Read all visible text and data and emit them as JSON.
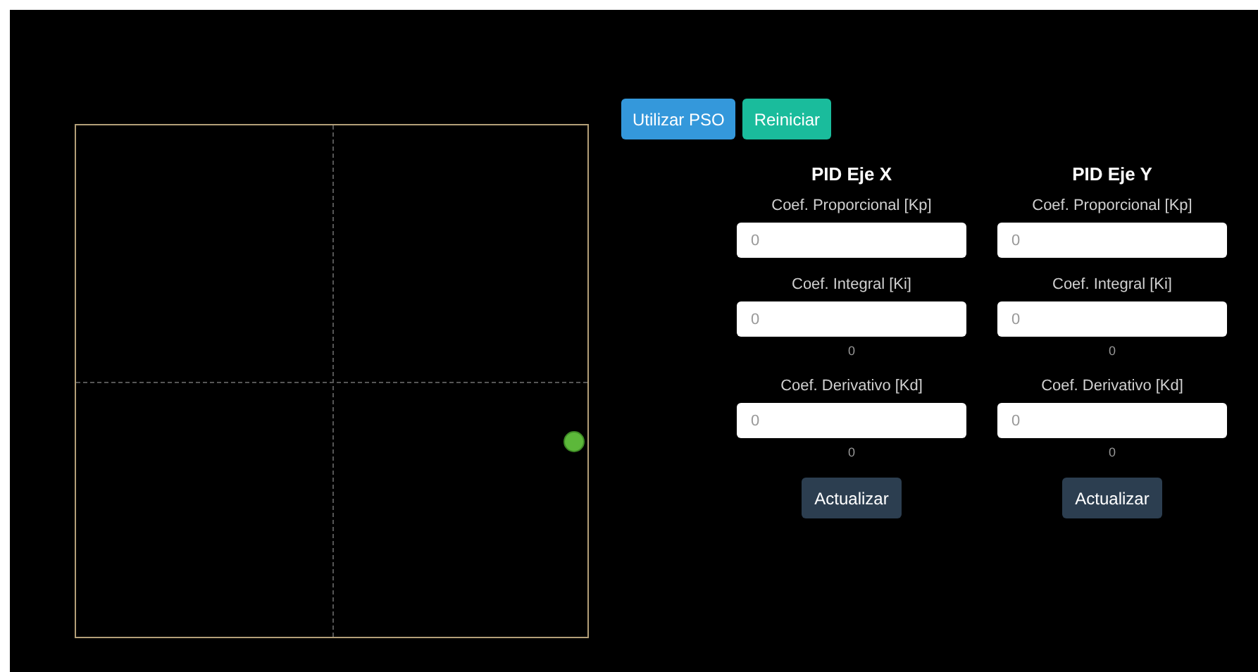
{
  "buttons": [
    {
      "label": "Utilizar PSO",
      "kind": "primary"
    },
    {
      "label": "Reiniciar",
      "kind": "success"
    }
  ],
  "controllers": [
    {
      "title": "PID Eje X",
      "fields": [
        {
          "label": "Coef. Proporcional [Kp]",
          "placeholder": "0"
        },
        {
          "label": "Coef. Integral [Ki]",
          "placeholder": "0",
          "reading": "0"
        },
        {
          "label": "Coef. Derivativo [Kd]",
          "placeholder": "0",
          "reading": "0"
        }
      ],
      "button": "Actualizar"
    },
    {
      "title": "PID Eje Y",
      "fields": [
        {
          "label": "Coef. Proporcional [Kp]",
          "placeholder": "0"
        },
        {
          "label": "Coef. Integral [Ki]",
          "placeholder": "0",
          "reading": "0"
        },
        {
          "label": "Coef. Derivativo [Kd]",
          "placeholder": "0",
          "reading": "0"
        }
      ],
      "button": "Actualizar"
    }
  ]
}
